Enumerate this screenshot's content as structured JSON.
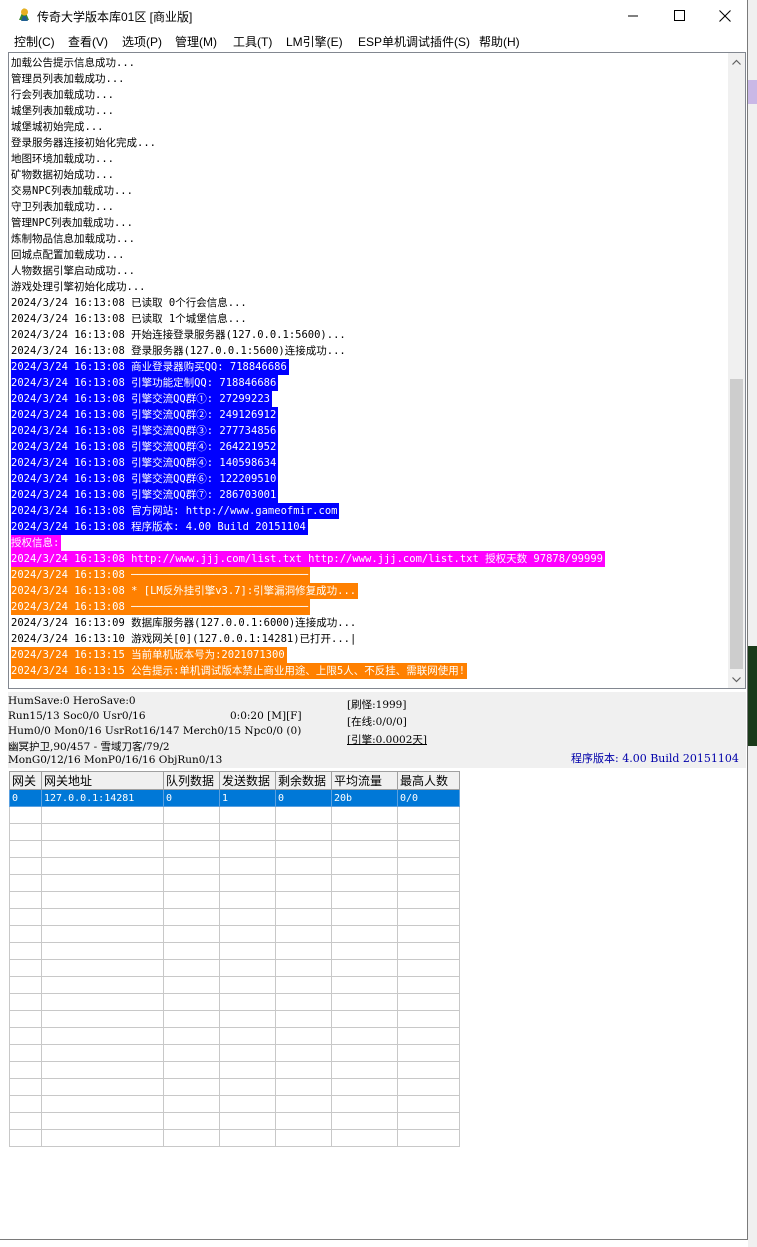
{
  "window": {
    "title": "传奇大学版本库01区 [商业版]",
    "controls": {
      "minimize": "minimize-icon",
      "maximize": "maximize-icon",
      "close": "close-icon"
    }
  },
  "menu": [
    "控制(C)",
    "查看(V)",
    "选项(P)",
    "管理(M)",
    "工具(T)",
    "LM引擎(E)",
    "ESP单机调试插件(S)",
    "帮助(H)"
  ],
  "log": [
    {
      "text": "加载公告提示信息成功...",
      "style": "plain"
    },
    {
      "text": "管理员列表加载成功...",
      "style": "plain"
    },
    {
      "text": "行会列表加载成功...",
      "style": "plain"
    },
    {
      "text": "城堡列表加载成功...",
      "style": "plain"
    },
    {
      "text": "城堡城初始完成...",
      "style": "plain"
    },
    {
      "text": "登录服务器连接初始化完成...",
      "style": "plain"
    },
    {
      "text": "地图环境加载成功...",
      "style": "plain"
    },
    {
      "text": "矿物数据初始成功...",
      "style": "plain"
    },
    {
      "text": "交易NPC列表加载成功...",
      "style": "plain"
    },
    {
      "text": "守卫列表加载成功...",
      "style": "plain"
    },
    {
      "text": "管理NPC列表加载成功...",
      "style": "plain"
    },
    {
      "text": "炼制物品信息加载成功...",
      "style": "plain"
    },
    {
      "text": "回城点配置加载成功...",
      "style": "plain"
    },
    {
      "text": "人物数据引擎启动成功...",
      "style": "plain"
    },
    {
      "text": "游戏处理引擎初始化成功...",
      "style": "plain"
    },
    {
      "text": "2024/3/24 16:13:08 已读取 0个行会信息...",
      "style": "plain"
    },
    {
      "text": "2024/3/24 16:13:08 已读取 1个城堡信息...",
      "style": "plain"
    },
    {
      "text": "2024/3/24 16:13:08 开始连接登录服务器(127.0.0.1:5600)...",
      "style": "plain"
    },
    {
      "text": "2024/3/24 16:13:08 登录服务器(127.0.0.1:5600)连接成功...",
      "style": "plain"
    },
    {
      "text": "2024/3/24 16:13:08 商业登录器购买QQ: 718846686",
      "style": "blue"
    },
    {
      "text": "2024/3/24 16:13:08 引擎功能定制QQ: 718846686",
      "style": "blue"
    },
    {
      "text": "2024/3/24 16:13:08 引擎交流QQ群①: 27299223",
      "style": "blue"
    },
    {
      "text": "2024/3/24 16:13:08 引擎交流QQ群②: 249126912",
      "style": "blue"
    },
    {
      "text": "2024/3/24 16:13:08 引擎交流QQ群③: 277734856",
      "style": "blue"
    },
    {
      "text": "2024/3/24 16:13:08 引擎交流QQ群④: 264221952",
      "style": "blue"
    },
    {
      "text": "2024/3/24 16:13:08 引擎交流QQ群④: 140598634",
      "style": "blue"
    },
    {
      "text": "2024/3/24 16:13:08 引擎交流QQ群⑥: 122209510",
      "style": "blue"
    },
    {
      "text": "2024/3/24 16:13:08 引擎交流QQ群⑦: 286703001",
      "style": "blue"
    },
    {
      "text": "2024/3/24 16:13:08 官方网站: http://www.gameofmir.com",
      "style": "blue"
    },
    {
      "text": "2024/3/24 16:13:08 程序版本: 4.00 Build 20151104",
      "style": "blue"
    },
    {
      "text": "授权信息:",
      "style": "magenta"
    },
    {
      "text": "2024/3/24 16:13:08 http://www.jjj.com/list.txt http://www.jjj.com/list.txt 授权天数 97878/99999",
      "style": "magenta"
    },
    {
      "text": "2024/3/24 16:13:08 ────────────────────────────",
      "style": "orange"
    },
    {
      "text": "2024/3/24 16:13:08 * [LM反外挂引擎v3.7]:引擎漏洞修复成功...",
      "style": "orange"
    },
    {
      "text": "2024/3/24 16:13:08 ────────────────────────────",
      "style": "orange"
    },
    {
      "text": "2024/3/24 16:13:09 数据库服务器(127.0.0.1:6000)连接成功...",
      "style": "plain"
    },
    {
      "text": "2024/3/24 16:13:10 游戏网关[0](127.0.0.1:14281)已打开...|",
      "style": "plain"
    },
    {
      "text": "2024/3/24 16:13:15 当前单机版本号为:2021071300",
      "style": "orange"
    },
    {
      "text": "2024/3/24 16:13:15 公告提示:单机调试版本禁止商业用途、上限5人、不反挂、需联网使用!",
      "style": "orange"
    }
  ],
  "status": {
    "line1": "HumSave:0 HeroSave:0",
    "line2a": "Run15/13 Soc0/0 Usr0/16",
    "line2b": "0:0:20 [M][F]",
    "line3": "Hum0/0 Mon0/16 UsrRot16/147 Merch0/15 Npc0/0 (0)",
    "line4": "幽冥护卫,90/457 - 雪域刀客/79/2",
    "line5": "MonG0/12/16 MonP0/16/16 ObjRun0/13",
    "refresh": "[刷怪:1999]",
    "online": "[在线:0/0/0]",
    "engine": "[引擎:0.0002天]",
    "version": "程序版本: 4.00 Build 20151104"
  },
  "gate_table": {
    "headers": [
      "网关",
      "网关地址",
      "队列数据",
      "发送数据",
      "剩余数据",
      "平均流量",
      "最高人数"
    ],
    "rows": [
      [
        "0",
        "127.0.0.1:14281",
        "0",
        "1",
        "0",
        "20b",
        "0/0"
      ]
    ]
  }
}
